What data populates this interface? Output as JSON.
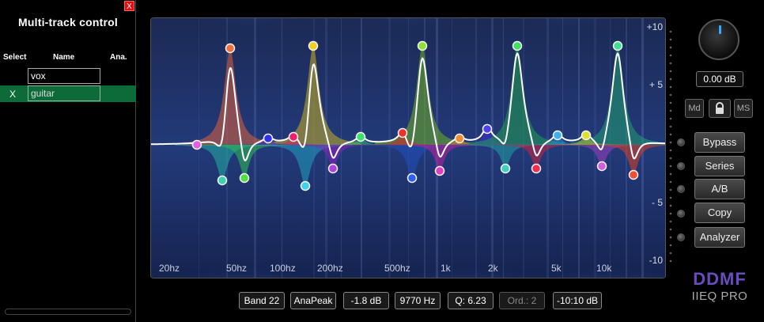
{
  "panel": {
    "title": "Multi-track control",
    "close_label": "X",
    "columns": {
      "select": "Select",
      "name": "Name",
      "ana": "Ana."
    },
    "tracks": [
      {
        "mark": "",
        "name": "vox",
        "selected": false
      },
      {
        "mark": "X",
        "name": "guitar",
        "selected": true
      }
    ]
  },
  "eq": {
    "db_labels": [
      "+10",
      "+ 5",
      "- 5",
      "-10"
    ],
    "freq_labels": [
      "20hz",
      "50hz",
      "100hz",
      "200hz",
      "500hz",
      "1k",
      "2k",
      "5k",
      "10k"
    ],
    "db_range": [
      -10,
      10
    ]
  },
  "controls": {
    "gain_value": "0.00 dB",
    "md_label": "Md",
    "lock_icon": "lock-icon",
    "ms_label": "MS",
    "buttons": [
      "Bypass",
      "Series",
      "A/B",
      "Copy",
      "Analyzer"
    ]
  },
  "brand": {
    "name": "DDMF",
    "product": "IIEQ PRO"
  },
  "bottom": {
    "band": "Band 22",
    "mode": "AnaPeak",
    "gain": "-1.8 dB",
    "freq": "9770 Hz",
    "q": "Q: 6.23",
    "order": "Ord.: 2",
    "range": "-10:10 dB"
  },
  "colors": {
    "accent_green": "#0d6b3a",
    "brand_purple": "#6a4bbf",
    "knob_indicator": "#33aaff"
  }
}
